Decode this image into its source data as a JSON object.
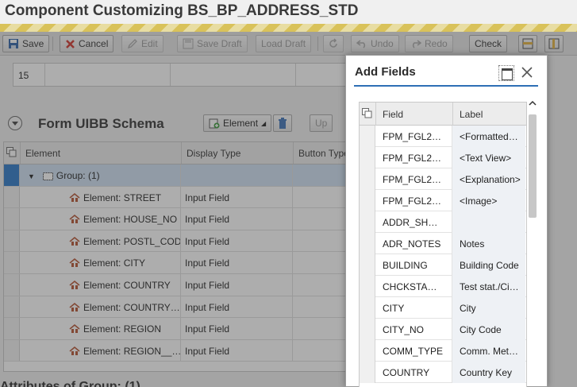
{
  "window": {
    "title": "Component Customizing BS_BP_ADDRESS_STD"
  },
  "toolbar": {
    "save": "Save",
    "cancel": "Cancel",
    "edit": "Edit",
    "save_draft": "Save Draft",
    "load_draft": "Load Draft",
    "undo": "Undo",
    "redo": "Redo",
    "check": "Check"
  },
  "top_grid": {
    "value": "15"
  },
  "schema": {
    "title": "Form UIBB Schema",
    "element_button": "Element",
    "up_button": "Up",
    "columns": [
      "Element",
      "Display Type",
      "Button Type"
    ],
    "group_row": "Group: (1)",
    "rows": [
      {
        "element": "Element: STREET",
        "display": "Input Field"
      },
      {
        "element": "Element: HOUSE_NO",
        "display": "Input Field"
      },
      {
        "element": "Element: POSTL_COD1",
        "display": "Input Field"
      },
      {
        "element": "Element: CITY",
        "display": "Input Field"
      },
      {
        "element": "Element: COUNTRY",
        "display": "Input Field"
      },
      {
        "element": "Element: COUNTRY…",
        "display": "Input Field"
      },
      {
        "element": "Element: REGION",
        "display": "Input Field"
      },
      {
        "element": "Element: REGION__…",
        "display": "Input Field"
      }
    ]
  },
  "attributes": {
    "title": "Attributes of Group: (1)"
  },
  "dialog": {
    "title": "Add Fields",
    "columns": {
      "field": "Field",
      "label": "Label"
    },
    "rows": [
      {
        "field": "FPM_FGL2…",
        "label": "<Formatted…"
      },
      {
        "field": "FPM_FGL2…",
        "label": "<Text View>"
      },
      {
        "field": "FPM_FGL2…",
        "label": "<Explanation>"
      },
      {
        "field": "FPM_FGL2…",
        "label": "<Image>"
      },
      {
        "field": "ADDR_SH…",
        "label": ""
      },
      {
        "field": "ADR_NOTES",
        "label": "Notes"
      },
      {
        "field": "BUILDING",
        "label": "Building Code"
      },
      {
        "field": "CHCKSTA…",
        "label": "Test stat./Ci…"
      },
      {
        "field": "CITY",
        "label": "City"
      },
      {
        "field": "CITY_NO",
        "label": "City Code"
      },
      {
        "field": "COMM_TYPE",
        "label": "Comm. Met…"
      },
      {
        "field": "COUNTRY",
        "label": "Country Key"
      }
    ]
  },
  "colors": {
    "accent": "#2e6fb5",
    "group_row": "#cfe0f3",
    "hazard": "#d9c25a"
  }
}
